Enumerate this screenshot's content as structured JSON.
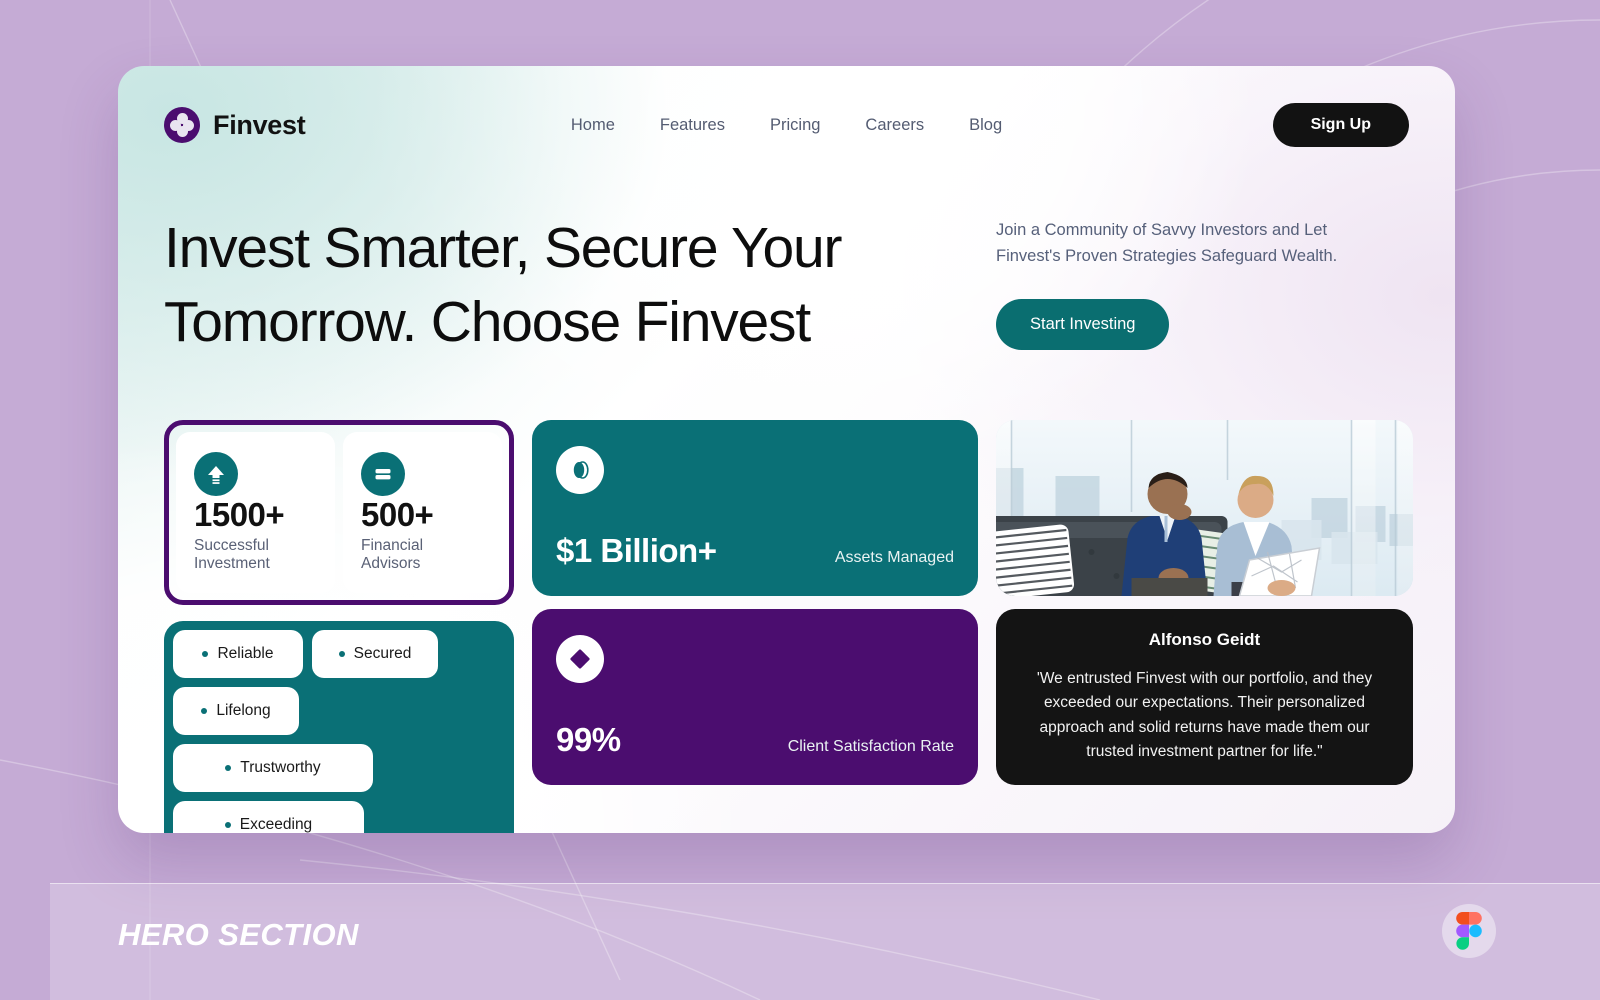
{
  "brand": {
    "name": "Finvest",
    "logo_icon": "clover-logo-icon"
  },
  "nav": {
    "links": [
      {
        "label": "Home"
      },
      {
        "label": "Features"
      },
      {
        "label": "Pricing"
      },
      {
        "label": "Careers"
      },
      {
        "label": "Blog"
      }
    ],
    "signup_label": "Sign Up"
  },
  "hero": {
    "headline": "Invest Smarter, Secure Your Tomorrow. Choose Finvest",
    "intro": "Join a Community of Savvy Investors and Let Finvest's Proven Strategies Safeguard Wealth.",
    "cta_label": "Start Investing"
  },
  "stat_cards": [
    {
      "value": "$1 Billion+",
      "label": "Assets Managed",
      "icon": "coin-icon",
      "color": "#0a7076"
    },
    {
      "value": "99%",
      "label": "Client Satisfaction Rate",
      "icon": "diamond-cluster-icon",
      "color": "#4b0d6f"
    }
  ],
  "photo": {
    "alt": "two-businessmen-with-laptop-in-office"
  },
  "testimonial": {
    "name": "Alfonso Geidt",
    "quote": "'We entrusted Finvest with our portfolio, and they exceeded our expectations. Their personalized approach and solid returns have made them our trusted investment partner for life.\""
  },
  "mini_stats": [
    {
      "value": "1500+",
      "label": "Successful Investment",
      "icon": "upload-arrow-icon"
    },
    {
      "value": "500+",
      "label": "Financial Advisors",
      "icon": "card-equals-icon"
    }
  ],
  "tags": [
    {
      "label": "Reliable"
    },
    {
      "label": "Secured"
    },
    {
      "label": "Lifelong"
    },
    {
      "label": "Trustworthy"
    },
    {
      "label": "Exceeding"
    }
  ],
  "footer": {
    "section_label": "HERO SECTION",
    "badge_icon": "figma-logo-icon"
  },
  "colors": {
    "background": "#c5abd5",
    "teal": "#0a7076",
    "teal_cta": "#0a6e70",
    "purple": "#4b0d6f",
    "black": "#121212",
    "muted_text": "#56607a"
  }
}
